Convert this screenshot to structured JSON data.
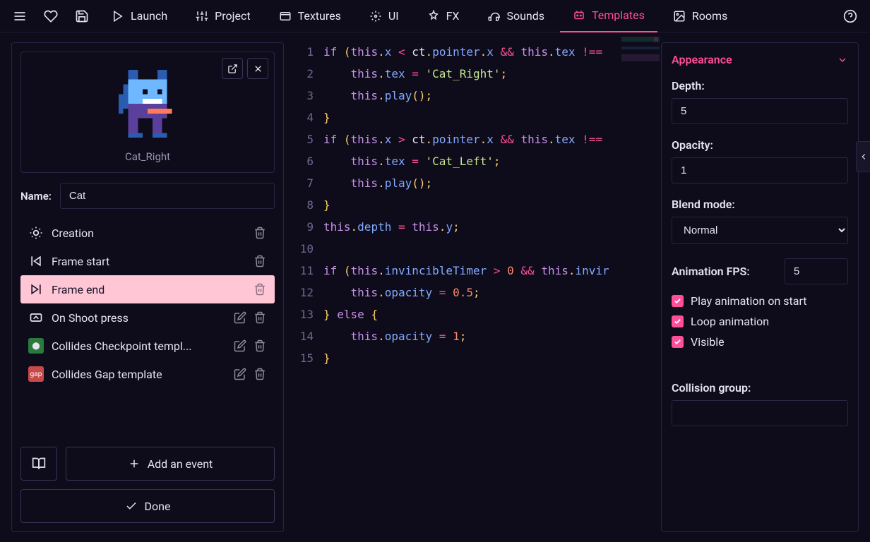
{
  "topbar": {
    "tabs": [
      {
        "icon": "launch",
        "label": "Launch"
      },
      {
        "icon": "project",
        "label": "Project"
      },
      {
        "icon": "textures",
        "label": "Textures"
      },
      {
        "icon": "ui",
        "label": "UI"
      },
      {
        "icon": "fx",
        "label": "FX"
      },
      {
        "icon": "sounds",
        "label": "Sounds"
      },
      {
        "icon": "templates",
        "label": "Templates"
      },
      {
        "icon": "rooms",
        "label": "Rooms"
      }
    ],
    "active_tab": "Templates"
  },
  "preview": {
    "sprite_name": "Cat_Right"
  },
  "template_name_label": "Name:",
  "template_name": "Cat",
  "events": [
    {
      "icon": "sun",
      "label": "Creation",
      "actions": [
        "trash"
      ]
    },
    {
      "icon": "framestart",
      "label": "Frame start",
      "actions": [
        "trash"
      ]
    },
    {
      "icon": "frameend",
      "label": "Frame end",
      "actions": [
        "trash"
      ],
      "active": true
    },
    {
      "icon": "shoot",
      "label": "On Shoot press",
      "actions": [
        "edit",
        "trash"
      ]
    },
    {
      "icon": "collide-checkpoint",
      "label": "Collides Checkpoint templ...",
      "actions": [
        "edit",
        "trash"
      ]
    },
    {
      "icon": "collide-gap",
      "label": "Collides Gap template",
      "actions": [
        "edit",
        "trash"
      ]
    }
  ],
  "buttons": {
    "add_event": "Add an event",
    "done": "Done"
  },
  "code_lines_count": 15,
  "appearance": {
    "section_title": "Appearance",
    "depth_label": "Depth:",
    "depth_value": "5",
    "opacity_label": "Opacity:",
    "opacity_value": "1",
    "blend_label": "Blend mode:",
    "blend_value": "Normal",
    "fps_label": "Animation FPS:",
    "fps_value": "5",
    "play_on_start_label": "Play animation on start",
    "play_on_start": true,
    "loop_label": "Loop animation",
    "loop": true,
    "visible_label": "Visible",
    "visible": true,
    "collision_label": "Collision group:",
    "collision_value": ""
  }
}
